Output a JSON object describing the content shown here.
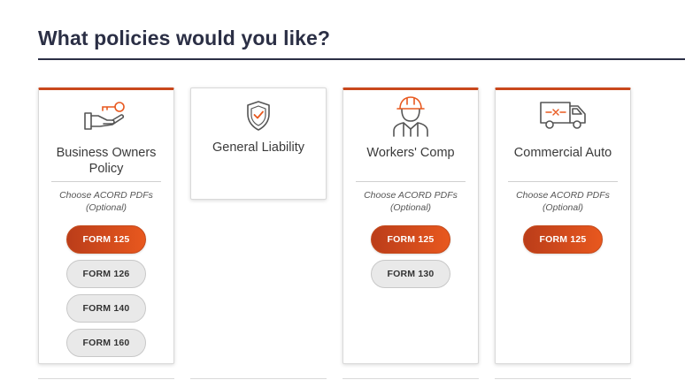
{
  "header": {
    "title": "What policies would you like?"
  },
  "colors": {
    "accent": "#c9471c",
    "title": "#2b2f45",
    "icon_gray": "#555555",
    "icon_orange": "#e8581e"
  },
  "policies": [
    {
      "name": "Business Owners Policy",
      "icon": "hand-key-icon",
      "selected": true,
      "choose_label": "Choose ACORD PDFs (Optional)",
      "forms": [
        {
          "label": "FORM 125",
          "active": true
        },
        {
          "label": "FORM 126",
          "active": false
        },
        {
          "label": "FORM 140",
          "active": false
        },
        {
          "label": "FORM 160",
          "active": false
        }
      ]
    },
    {
      "name": "General Liability",
      "icon": "shield-check-icon",
      "selected": false
    },
    {
      "name": "Workers' Comp",
      "icon": "worker-hardhat-icon",
      "selected": true,
      "choose_label": "Choose ACORD PDFs (Optional)",
      "forms": [
        {
          "label": "FORM 125",
          "active": true
        },
        {
          "label": "FORM 130",
          "active": false
        }
      ]
    },
    {
      "name": "Commercial Auto",
      "icon": "van-icon",
      "selected": true,
      "choose_label": "Choose ACORD PDFs (Optional)",
      "forms": [
        {
          "label": "FORM 125",
          "active": true
        }
      ]
    }
  ]
}
